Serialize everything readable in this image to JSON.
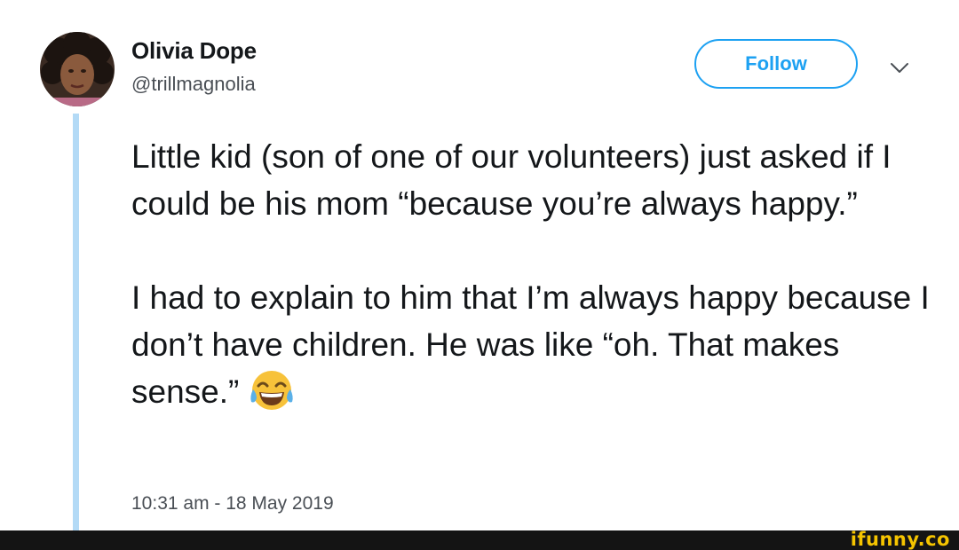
{
  "user": {
    "name": "Olivia Dope",
    "handle": "@trillmagnolia",
    "avatar_icon": "profile-photo"
  },
  "follow_button": {
    "label": "Follow",
    "color": "#1da1f2"
  },
  "menu_icon": "chevron-down-icon",
  "tweet": {
    "paragraph1": "Little kid (son of one of our volunteers) just asked if I could be his mom “because you’re always happy.”",
    "paragraph2": "I had to explain to him that I’m always happy because I don’t have children. He was like “oh. That makes sense.”",
    "emoji": "face-with-tears-of-joy",
    "timestamp": "10:31 am - 18 May 2019"
  },
  "thread_line_color": "#b3daf6",
  "watermark": {
    "text": "ifunny.co",
    "color": "#f5c400"
  }
}
